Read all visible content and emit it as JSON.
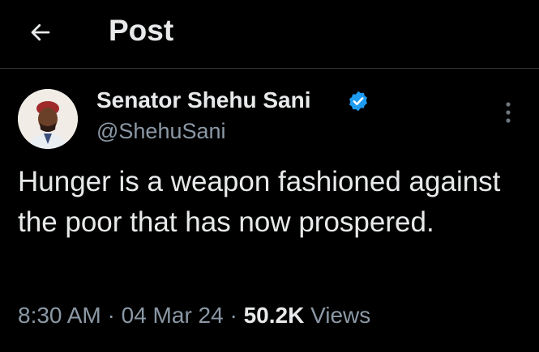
{
  "header": {
    "title": "Post",
    "back_icon": "arrow-left-icon"
  },
  "author": {
    "display_name": "Senator Shehu Sani",
    "handle": "@ShehuSani",
    "verified_icon": "verified-badge-icon",
    "verified_color": "#1d9bf0"
  },
  "post": {
    "text": "Hunger is a weapon fashioned against the poor that has now prospered.",
    "time": "8:30 AM",
    "separator": "·",
    "date": "04 Mar 24",
    "views_count": "50.2K",
    "views_label": "Views"
  },
  "menu": {
    "more_icon": "more-vertical-icon"
  },
  "colors": {
    "background": "#000000",
    "primary_text": "#e7e9ea",
    "secondary_text": "#8b98a5",
    "divider": "#2f3336"
  }
}
